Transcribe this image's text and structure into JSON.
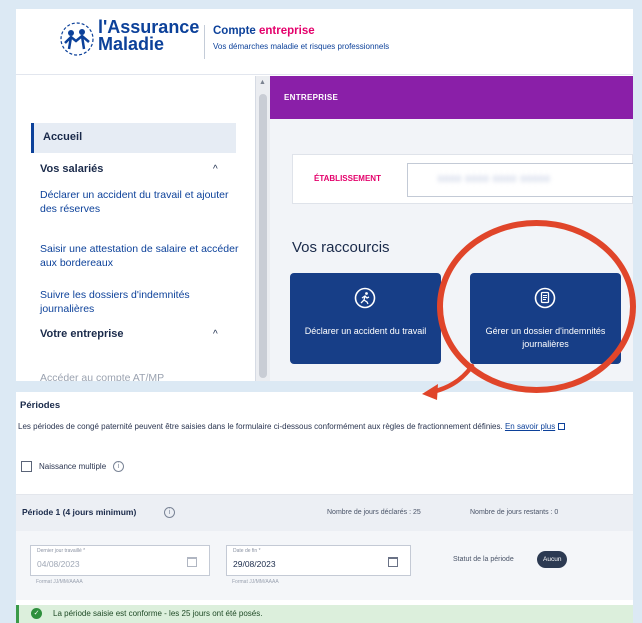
{
  "header": {
    "logo_line1": "l'Assurance",
    "logo_line2": "Maladie",
    "title_prefix": "Compte",
    "title_accent": "entreprise",
    "subtitle": "Vos démarches maladie et risques professionnels"
  },
  "sidebar": {
    "home": "Accueil",
    "section_salaries": "Vos salariés",
    "link_accident": "Déclarer un accident du travail et ajouter des réserves",
    "link_attestation": "Saisir une attestation de salaire et accéder aux bordereaux",
    "link_dossiers": "Suivre les dossiers d'indemnités journalières",
    "section_entreprise": "Votre entreprise",
    "link_compte_atmp": "Accéder au compte AT/MP",
    "chevron": "^"
  },
  "content": {
    "banner": "ENTREPRISE",
    "etablissement_label": "ÉTABLISSEMENT",
    "etablissement_value": "0000 0000 0000 00000",
    "raccourcis_title": "Vos raccourcis",
    "tile1_label": "Déclarer un accident du travail",
    "tile2_label": "Gérer un dossier d'indemnités journalières"
  },
  "periodes": {
    "title": "Périodes",
    "description": "Les périodes de congé paternité peuvent être saisies dans le formulaire ci-dessous conformément aux règles de fractionnement définies.",
    "learn_more": "En savoir plus",
    "checkbox_label": "Naissance multiple",
    "period_title": "Période 1 (4 jours minimum)",
    "declared_label": "Nombre de jours déclarés : 25",
    "remaining_label": "Nombre de jours restants : 0",
    "field1_label": "Dernier jour travaillé *",
    "field1_value": "04/08/2023",
    "field1_format": "Format JJ/MM/AAAA",
    "field2_label": "Date de fin *",
    "field2_value": "29/08/2023",
    "field2_format": "Format JJ/MM/AAAA",
    "statut_label": "Statut de la période",
    "statut_value": "Aucun",
    "success_message": "La période saisie est conforme - les 25 jours ont été posés."
  },
  "colors": {
    "brand_blue": "#0c419a",
    "accent_pink": "#e4006b",
    "banner_purple": "#8a1fa8",
    "tile_blue": "#173e87",
    "highlight_red": "#e0452a",
    "success_green": "#3a9a48"
  },
  "icons": {
    "logo": "people-logo-icon",
    "tile1": "running-person-icon",
    "tile2": "document-icon",
    "info": "info-icon",
    "calendar": "calendar-icon",
    "ok": "check-circle-icon",
    "external": "external-link-icon"
  }
}
